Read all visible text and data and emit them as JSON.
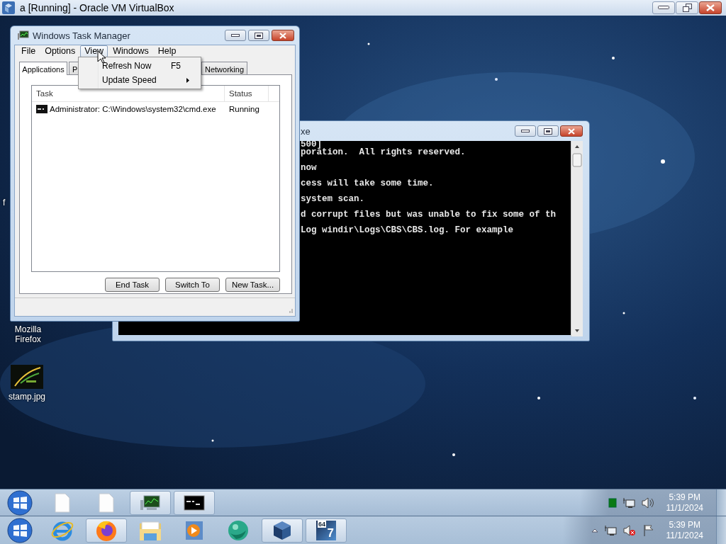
{
  "host_window": {
    "title": "a [Running] - Oracle VM VirtualBox"
  },
  "desktop_icons": [
    {
      "kind": "text",
      "label": "f"
    },
    {
      "kind": "text",
      "label": "Mozilla Firefox"
    },
    {
      "kind": "picture",
      "label": "stamp.jpg"
    }
  ],
  "task_manager": {
    "title": "Windows Task Manager",
    "menu": [
      {
        "label": "File",
        "selected": false
      },
      {
        "label": "Options",
        "selected": false
      },
      {
        "label": "View",
        "selected": true
      },
      {
        "label": "Windows",
        "selected": false
      },
      {
        "label": "Help",
        "selected": false
      }
    ],
    "open_menu": [
      {
        "label": "Refresh Now",
        "shortcut": "F5",
        "submenu": false
      },
      {
        "label": "Update Speed",
        "submenu": true
      }
    ],
    "tabs": [
      {
        "label": "Applications",
        "selected": true
      },
      {
        "label": "P",
        "selected": false
      },
      {
        "label": "Networking",
        "selected": false
      }
    ],
    "columns": [
      "Task",
      "Status"
    ],
    "rows": [
      {
        "task": "Administrator: C:\\Windows\\system32\\cmd.exe",
        "status": "Running"
      }
    ],
    "buttons": [
      "End Task",
      "Switch To",
      "New Task..."
    ]
  },
  "console_window": {
    "title": "xe",
    "lines": [
      {
        "text": "500]"
      },
      {
        "text": "poration.  All rights reserved."
      },
      {
        "text": "now"
      },
      {
        "text": "cess will take some time."
      },
      {
        "text": "system scan."
      },
      {
        "text": "d corrupt files but was unable to fix some of th"
      },
      {
        "text": "Log windir\\Logs\\CBS\\CBS.log. For example"
      }
    ]
  },
  "guest_taskbar": {
    "items": [
      {
        "kind": "document",
        "active": false
      },
      {
        "kind": "document",
        "active": false
      },
      {
        "kind": "task-manager",
        "active": true
      },
      {
        "kind": "console",
        "active": true
      }
    ],
    "tray": [
      {
        "kind": "meter"
      },
      {
        "kind": "network"
      },
      {
        "kind": "speaker",
        "muted": false
      }
    ],
    "time": "5:39 PM",
    "date": "11/1/2024"
  },
  "host_taskbar": {
    "items": [
      {
        "kind": "ie",
        "active": false
      },
      {
        "kind": "firefox",
        "active": true
      },
      {
        "kind": "folder",
        "active": false
      },
      {
        "kind": "media",
        "active": false
      },
      {
        "kind": "globe",
        "active": false
      },
      {
        "kind": "cube",
        "active": true
      },
      {
        "kind": "tile",
        "active": true,
        "small": "64",
        "big": "7"
      }
    ],
    "tray": [
      {
        "kind": "chevron"
      },
      {
        "kind": "network"
      },
      {
        "kind": "speaker",
        "muted": true
      },
      {
        "kind": "flag"
      }
    ],
    "time": "5:39 PM",
    "date": "11/1/2024"
  }
}
